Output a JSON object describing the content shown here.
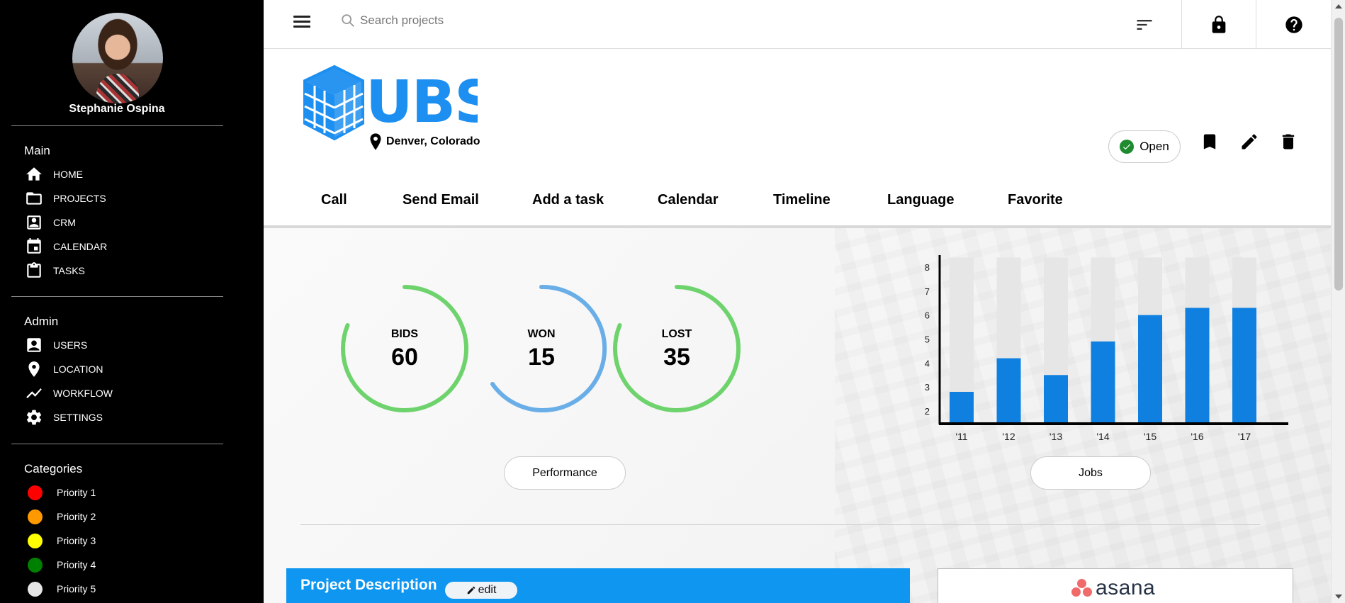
{
  "user": {
    "name": "Stephanie Ospina"
  },
  "sidebar": {
    "main_title": "Main",
    "main_items": [
      {
        "label": "HOME",
        "icon": "home-icon"
      },
      {
        "label": "PROJECTS",
        "icon": "folder-icon"
      },
      {
        "label": "CRM",
        "icon": "contact-icon"
      },
      {
        "label": "CALENDAR",
        "icon": "calendar-icon"
      },
      {
        "label": "TASKS",
        "icon": "clipboard-icon"
      }
    ],
    "admin_title": "Admin",
    "admin_items": [
      {
        "label": "USERS",
        "icon": "user-icon"
      },
      {
        "label": "LOCATION",
        "icon": "location-pin-icon"
      },
      {
        "label": "WORKFLOW",
        "icon": "trend-line-icon"
      },
      {
        "label": "SETTINGS",
        "icon": "gear-icon"
      }
    ],
    "categories_title": "Categories",
    "categories": [
      {
        "label": "Priority 1",
        "color": "#ff0000"
      },
      {
        "label": "Priority 2",
        "color": "#ff9900"
      },
      {
        "label": "Priority 3",
        "color": "#ffff00"
      },
      {
        "label": "Priority 4",
        "color": "#008000"
      },
      {
        "label": "Priority 5",
        "color": "#e6e6e6"
      }
    ]
  },
  "topbar": {
    "search_placeholder": "Search projects",
    "icons": [
      "menu-icon",
      "search-icon",
      "sort-icon",
      "lock-icon",
      "help-icon"
    ]
  },
  "project": {
    "logo_text": "UBS",
    "location": "Denver, Colorado",
    "status": "Open",
    "status_color": "#1e8b2f",
    "actions": [
      "bookmark-icon",
      "edit-icon",
      "delete-icon"
    ]
  },
  "tabs": [
    "Call",
    "Send Email",
    "Add a task",
    "Calendar",
    "Timeline",
    "Language",
    "Favorite"
  ],
  "stats": [
    {
      "label": "BIDS",
      "value": "60",
      "color": "#6fd36d"
    },
    {
      "label": "WON",
      "value": "15",
      "color": "#6aaee8"
    },
    {
      "label": "LOST",
      "value": "35",
      "color": "#6fd36d"
    }
  ],
  "buttons": {
    "performance": "Performance",
    "jobs": "Jobs"
  },
  "chart_data": {
    "type": "bar",
    "categories": [
      "'11",
      "'12",
      "'13",
      "'14",
      "'15",
      "'16",
      "'17"
    ],
    "values": [
      2.8,
      4.2,
      3.5,
      4.9,
      6.0,
      6.3,
      6.3
    ],
    "background_max": 8.4,
    "y_ticks": [
      2,
      3,
      4,
      5,
      6,
      7,
      8
    ],
    "ylim": [
      1.5,
      8.5
    ],
    "bar_color": "#0f80e0",
    "background_color": "#e6e6e6",
    "title": "",
    "xlabel": "",
    "ylabel": ""
  },
  "description": {
    "title": "Project Description",
    "edit_label": "edit"
  },
  "integration": {
    "name": "asana"
  }
}
